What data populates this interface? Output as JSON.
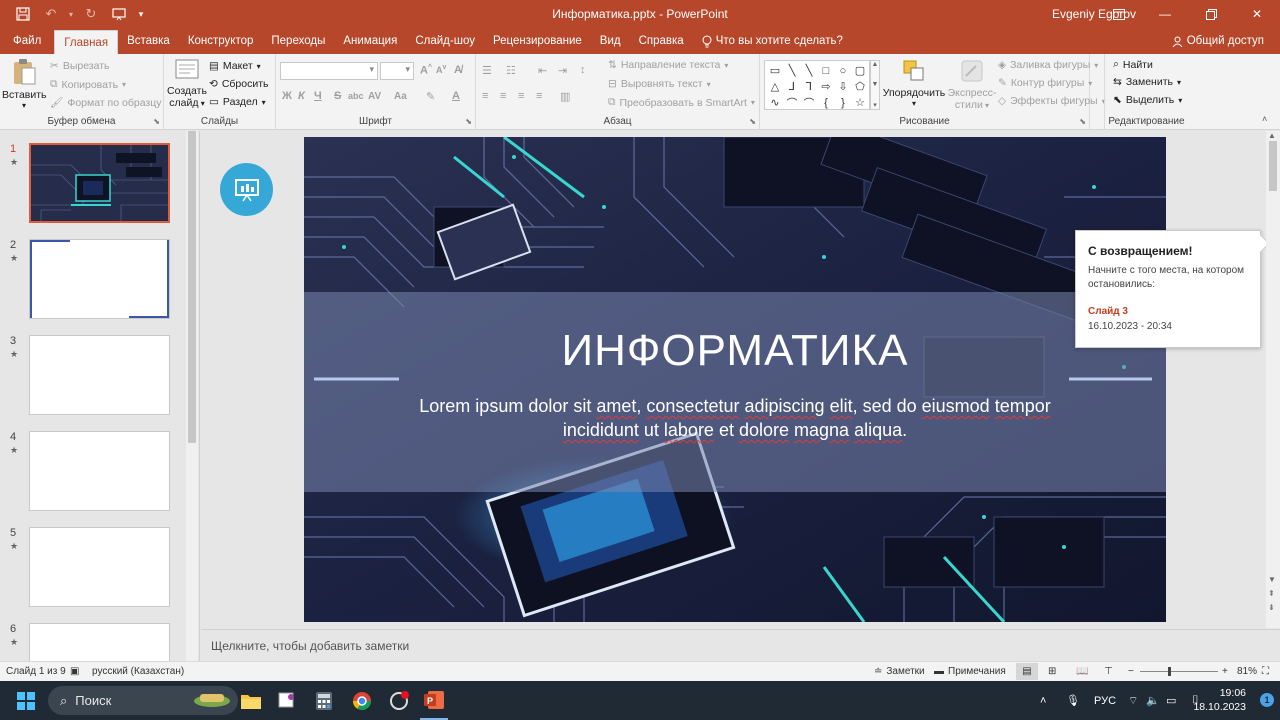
{
  "app": {
    "doc_title": "Информатика.pptx  -  PowerPoint",
    "user": "Evgeniy Egorov",
    "accent": "#b7472a"
  },
  "tabs": [
    "Файл",
    "Главная",
    "Вставка",
    "Конструктор",
    "Переходы",
    "Анимация",
    "Слайд-шоу",
    "Рецензирование",
    "Вид",
    "Справка"
  ],
  "tell_me": "Что вы хотите сделать?",
  "share": "Общий доступ",
  "ribbon": {
    "clipboard": {
      "paste": "Вставить",
      "cut": "Вырезать",
      "copy": "Копировать",
      "format_painter": "Формат по образцу",
      "label": "Буфер обмена"
    },
    "slides": {
      "new_slide_1": "Создать",
      "new_slide_2": "слайд",
      "layout": "Макет",
      "reset": "Сбросить",
      "section": "Раздел",
      "label": "Слайды"
    },
    "font": {
      "bold": "Ж",
      "italic": "К",
      "underline": "Ч",
      "strike": "S",
      "shadow": "abc",
      "spacing": "AV",
      "case": "Aa",
      "grow": "A",
      "shrink": "A",
      "color": "A",
      "label": "Шрифт"
    },
    "paragraph": {
      "text_direction": "Направление текста",
      "align_text": "Выровнять текст",
      "smartart": "Преобразовать в SmartArt",
      "label": "Абзац"
    },
    "drawing": {
      "arrange": "Упорядочить",
      "quick_styles_1": "Экспресс-",
      "quick_styles_2": "стили",
      "fill": "Заливка фигуры",
      "outline": "Контур фигуры",
      "effects": "Эффекты фигуры",
      "label": "Рисование"
    },
    "editing": {
      "find": "Найти",
      "replace": "Заменить",
      "select": "Выделить",
      "label": "Редактирование"
    }
  },
  "thumbnails": [
    {
      "num": "1",
      "star": "★"
    },
    {
      "num": "2",
      "star": "★"
    },
    {
      "num": "3",
      "star": "★"
    },
    {
      "num": "4",
      "star": "★"
    },
    {
      "num": "5",
      "star": "★"
    },
    {
      "num": "6",
      "star": "★"
    }
  ],
  "slide": {
    "title": "ИНФОРМАТИКА",
    "subtitle_parts": [
      "Lorem ipsum dolor sit ",
      "amet",
      ", ",
      "consectetur",
      " ",
      "adipiscing",
      " ",
      "elit",
      ", sed do ",
      "eiusmod",
      " ",
      "tempor",
      " ",
      "incididunt",
      " ut ",
      "labore",
      " et ",
      "dolore",
      " ",
      "magna",
      " ",
      "aliqua",
      "."
    ]
  },
  "popup": {
    "title": "С возвращением!",
    "message": "Начните с того места, на котором остановились:",
    "link": "Слайд 3",
    "date": "16.10.2023 - 20:34"
  },
  "notes_placeholder": "Щелкните, чтобы добавить заметки",
  "status": {
    "slide_count": "Слайд 1 из 9",
    "language": "русский (Казахстан)",
    "notes": "Заметки",
    "comments": "Примечания",
    "zoom": "81%"
  },
  "taskbar": {
    "search": "Поиск",
    "lang": "РУС",
    "time": "19:06",
    "date": "18.10.2023",
    "notifications": "1"
  }
}
